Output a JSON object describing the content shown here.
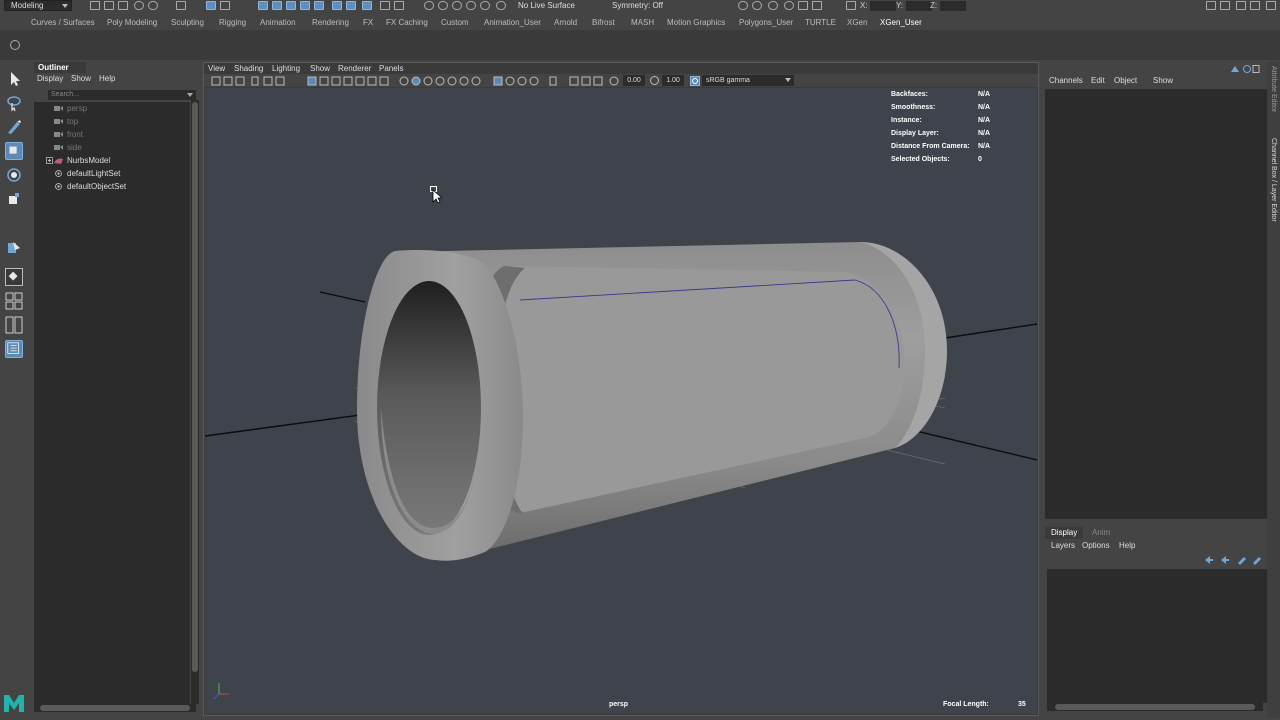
{
  "status_line": {
    "mode": "Modeling",
    "live_surface": "No Live Surface",
    "symmetry": "Symmetry: Off",
    "x_label": "X:",
    "y_label": "Y:",
    "z_label": "Z:"
  },
  "shelf": {
    "tabs": [
      "Curves / Surfaces",
      "Poly Modeling",
      "Sculpting",
      "Rigging",
      "Animation",
      "Rendering",
      "FX",
      "FX Caching",
      "Custom",
      "Animation_User",
      "Arnold",
      "Bifrost",
      "MASH",
      "Motion Graphics",
      "Polygons_User",
      "TURTLE",
      "XGen",
      "XGen_User"
    ],
    "active_tab": "XGen_User"
  },
  "outliner": {
    "title": "Outliner",
    "menus": [
      "Display",
      "Show",
      "Help"
    ],
    "search_placeholder": "Search...",
    "items": [
      {
        "label": "persp",
        "icon": "camera-icon",
        "dim": true
      },
      {
        "label": "top",
        "icon": "camera-icon",
        "dim": true
      },
      {
        "label": "front",
        "icon": "camera-icon",
        "dim": true
      },
      {
        "label": "side",
        "icon": "camera-icon",
        "dim": true
      },
      {
        "label": "NurbsModel",
        "icon": "nurbs-icon",
        "dim": false,
        "expandable": true
      },
      {
        "label": "defaultLightSet",
        "icon": "set-icon",
        "dim": false
      },
      {
        "label": "defaultObjectSet",
        "icon": "set-icon",
        "dim": false
      }
    ]
  },
  "viewport": {
    "menus": [
      "View",
      "Shading",
      "Lighting",
      "Show",
      "Renderer",
      "Panels"
    ],
    "exposure": "0.00",
    "gamma": "1.00",
    "color_space": "sRGB gamma",
    "hud": [
      {
        "label": "Backfaces:",
        "value": "N/A"
      },
      {
        "label": "Smoothness:",
        "value": "N/A"
      },
      {
        "label": "Instance:",
        "value": "N/A"
      },
      {
        "label": "Display Layer:",
        "value": "N/A"
      },
      {
        "label": "Distance From Camera:",
        "value": "N/A"
      },
      {
        "label": "Selected Objects:",
        "value": "0"
      }
    ],
    "camera": "persp",
    "focal_length_label": "Focal Length:",
    "focal_length_value": "35"
  },
  "channel_box": {
    "menus": [
      "Channels",
      "Edit",
      "Object",
      "Show"
    ]
  },
  "layer_editor": {
    "tabs": [
      "Display",
      "Anim"
    ],
    "active_tab": "Display",
    "menus": [
      "Layers",
      "Options",
      "Help"
    ]
  },
  "side_tabs": [
    "Attribute Editor",
    "Channel Box / Layer Editor"
  ],
  "colors": {
    "panel": "#444444",
    "dark_field": "#2b2b2b",
    "viewport_bg": "#3f434b",
    "highlight": "#5b8ab8",
    "logo": "#1fb5ad"
  }
}
